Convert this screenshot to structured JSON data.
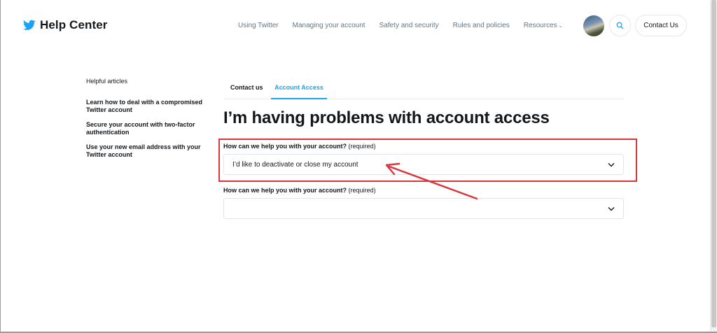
{
  "header": {
    "brand": "Help Center",
    "nav": [
      {
        "label": "Using Twitter"
      },
      {
        "label": "Managing your account"
      },
      {
        "label": "Safety and security"
      },
      {
        "label": "Rules and policies"
      },
      {
        "label": "Resources",
        "chevron": "⌄"
      }
    ],
    "contact_button": "Contact Us"
  },
  "sidebar": {
    "heading": "Helpful articles",
    "links": [
      {
        "line1": "Learn how to deal with a compromised",
        "line2": "Twitter account"
      },
      {
        "line1": "Secure your account with two-factor",
        "line2": "authentication"
      },
      {
        "line1": "Use your new email address with your",
        "line2": "Twitter account"
      }
    ]
  },
  "tabs": [
    {
      "label": "Contact us"
    },
    {
      "label": "Account Access"
    }
  ],
  "main": {
    "title": "I’m having problems with account access",
    "field1": {
      "label": "How can we help you with your account?",
      "required": "(required)",
      "value": "I’d like to deactivate or close my account"
    },
    "field2": {
      "label": "How can we help you with your account?",
      "required": "(required)",
      "value": ""
    }
  },
  "icons": {
    "brand": "twitter-bird-icon",
    "search": "search-icon",
    "select": "chevron-down-icon"
  },
  "colors": {
    "accent": "#1da1f2",
    "annotation": "#d9363e",
    "text": "#14171a",
    "muted": "#657786"
  }
}
